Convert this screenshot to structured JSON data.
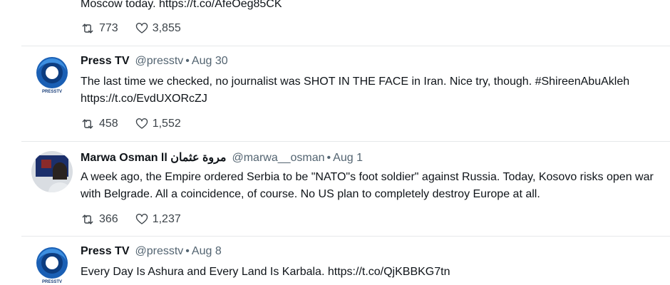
{
  "tweets": [
    {
      "text": "Moscow today. https://t.co/AfeOeg85CK",
      "retweets": "773",
      "likes": "3,855"
    },
    {
      "name": "Press TV",
      "handle": "@presstv",
      "separator": "•",
      "date": "Aug 30",
      "avatar_label": "PRESSTV",
      "text": "The last time we checked, no journalist was SHOT IN THE FACE in Iran. Nice try, though. #ShireenAbuAkleh https://t.co/EvdUXORcZJ",
      "retweets": "458",
      "likes": "1,552"
    },
    {
      "name": "Marwa Osman ll مروة عثمان",
      "handle": "@marwa__osman",
      "separator": "•",
      "date": "Aug 1",
      "text": "A week ago, the Empire ordered Serbia to be \"NATO\"s foot soldier\" against Russia. Today, Kosovo risks open war with Belgrade. All a coincidence, of course. No US plan to completely destroy Europe at all.",
      "retweets": "366",
      "likes": "1,237"
    },
    {
      "name": "Press TV",
      "handle": "@presstv",
      "separator": "•",
      "date": "Aug 8",
      "avatar_label": "PRESSTV",
      "text": "Every Day Is Ashura and Every Land Is Karbala. https://t.co/QjKBBKG7tn"
    }
  ],
  "colors": {
    "text": "#0f1419",
    "secondary": "#536471",
    "divider": "#e6e8ea",
    "presstv_blue": "#1565c0"
  },
  "icons": {
    "retweet": "retweet-icon",
    "like": "heart-icon"
  }
}
